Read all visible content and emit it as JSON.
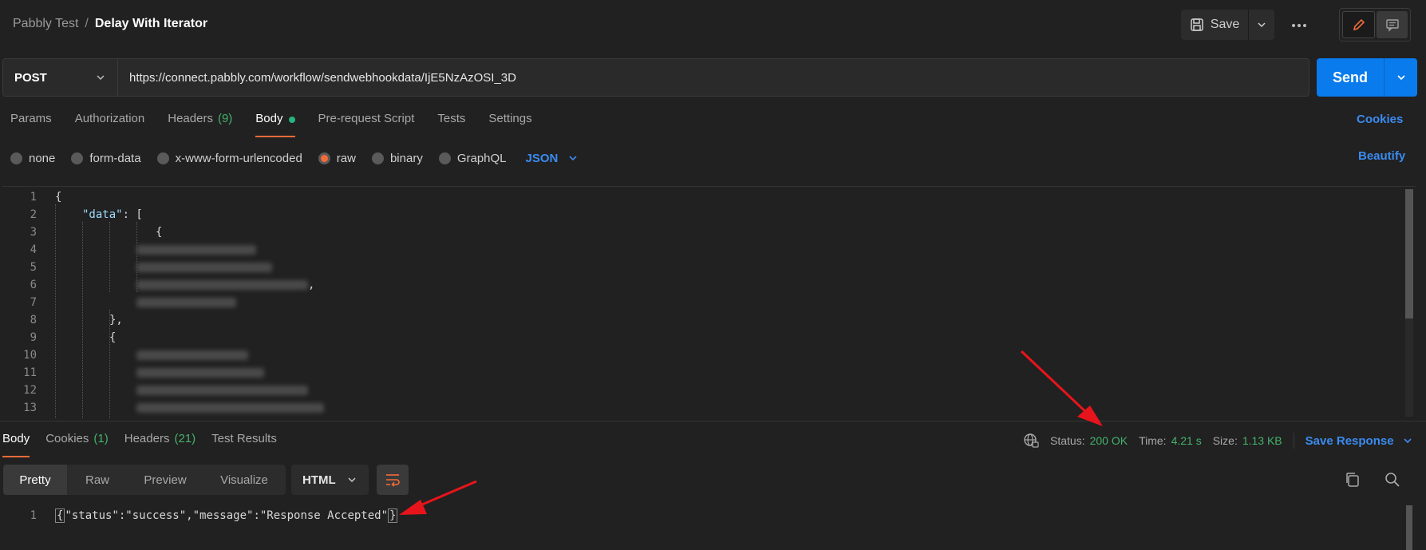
{
  "breadcrumb": {
    "parent": "Pabbly Test",
    "separator": "/",
    "current": "Delay With Iterator"
  },
  "toolbar": {
    "save_label": "Save",
    "more_label": "···"
  },
  "request": {
    "method": "POST",
    "url": "https://connect.pabbly.com/workflow/sendwebhookdata/IjE5NzAzOSI_3D",
    "send_label": "Send"
  },
  "request_tabs": {
    "params": "Params",
    "authorization": "Authorization",
    "headers": "Headers",
    "headers_count": "(9)",
    "body": "Body",
    "prerequest": "Pre-request Script",
    "tests": "Tests",
    "settings": "Settings",
    "cookies_link": "Cookies"
  },
  "body_types": {
    "none": "none",
    "form_data": "form-data",
    "urlencoded": "x-www-form-urlencoded",
    "raw": "raw",
    "binary": "binary",
    "graphql": "GraphQL",
    "selected_format": "JSON",
    "beautify_link": "Beautify"
  },
  "editor": {
    "line_numbers": [
      "1",
      "2",
      "3",
      "4",
      "5",
      "6",
      "7",
      "8",
      "9",
      "10",
      "11",
      "12",
      "13"
    ],
    "line1": "{",
    "data_key": "\"data\"",
    "data_after": ": [",
    "line3": "{",
    "line6_tail": ",",
    "line8": "},",
    "line9": "{"
  },
  "response_tabs": {
    "body": "Body",
    "cookies": "Cookies",
    "cookies_count": "(1)",
    "headers": "Headers",
    "headers_count": "(21)",
    "test_results": "Test Results"
  },
  "response_meta": {
    "status_label": "Status:",
    "status_value": "200 OK",
    "time_label": "Time:",
    "time_value": "4.21 s",
    "size_label": "Size:",
    "size_value": "1.13 KB",
    "save_response": "Save Response"
  },
  "response_view": {
    "pretty": "Pretty",
    "raw": "Raw",
    "preview": "Preview",
    "visualize": "Visualize",
    "format": "HTML",
    "line_number": "1",
    "open_brace": "{",
    "content": "\"status\":\"success\",\"message\":\"Response Accepted\"",
    "close_brace": "}"
  },
  "colors": {
    "accent_orange": "#f26b3a",
    "link_blue": "#3b8bf0",
    "send_blue": "#097bed",
    "status_green": "#45b26b",
    "annotation_red": "#e8141b"
  }
}
